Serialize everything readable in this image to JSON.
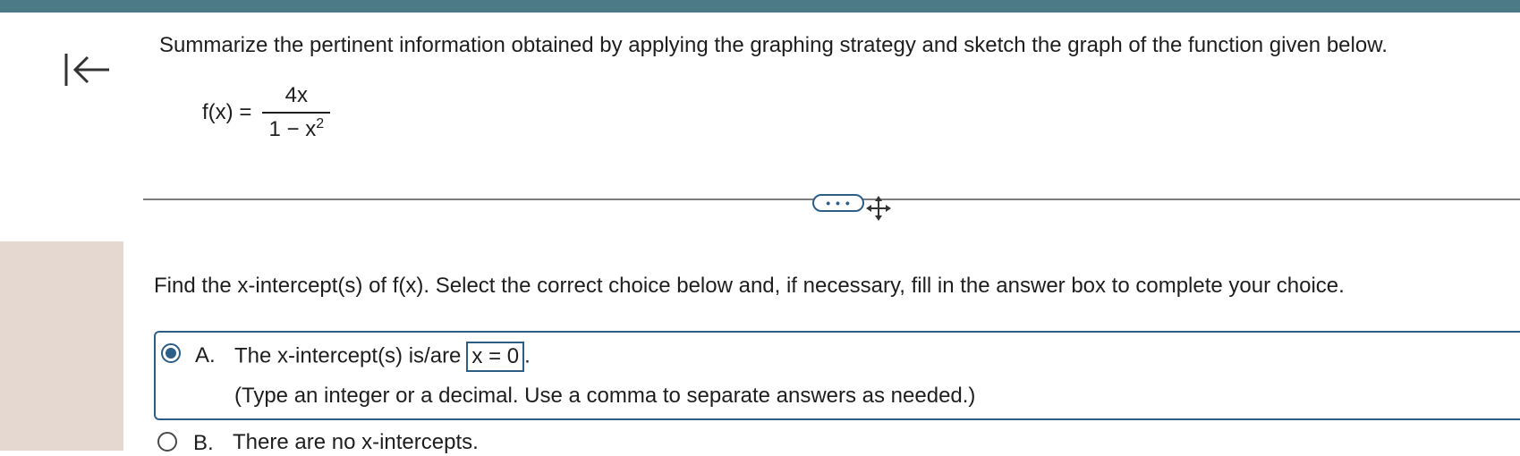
{
  "question": {
    "text": "Summarize the pertinent information obtained by applying the graphing strategy and sketch the graph of the function given below.",
    "function_lhs": "f(x) =",
    "numerator": "4x",
    "denominator_base": "1 − x",
    "denominator_exponent": "2"
  },
  "toolbar": {
    "more_label": "• • •"
  },
  "prompt": {
    "text": "Find the x-intercept(s) of f(x). Select the correct choice below and, if necessary, fill in the answer box to complete your choice."
  },
  "choices": [
    {
      "letter": "A.",
      "text_before": "The x-intercept(s) is/are",
      "answer_value": "x = 0",
      "text_after": ".",
      "hint": "(Type an integer or a decimal. Use a comma to separate answers as needed.)",
      "selected": true
    },
    {
      "letter": "B.",
      "text": "There are no x-intercepts.",
      "selected": false
    }
  ],
  "colors": {
    "accent": "#2d5e87",
    "topbar": "#4c7a86"
  }
}
